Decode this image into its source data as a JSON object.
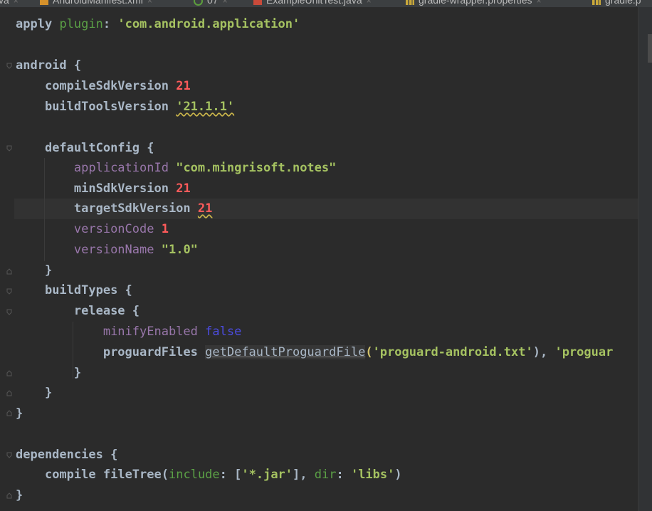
{
  "tabs": [
    {
      "label": "va",
      "icon": "java-file-icon"
    },
    {
      "label": "AndroidManifest.xml",
      "icon": "xml-file-icon"
    },
    {
      "label": "07",
      "icon": "refresh-icon"
    },
    {
      "label": "ExampleUnitTest.java",
      "icon": "java-test-file-icon"
    },
    {
      "label": "gradle-wrapper.properties",
      "icon": "properties-file-icon"
    },
    {
      "label": "gradle.p",
      "icon": "properties-file-icon"
    }
  ],
  "close_glyph": "×",
  "colors": {
    "background": "#2b2b2b",
    "keyword": "#a9b7c6",
    "string": "#6a8759",
    "number": "#ff5b5b",
    "property": "#9876aa",
    "named_arg": "#467cda"
  },
  "code": {
    "l1": [
      "apply",
      "plugin",
      ": ",
      "'com.android.application'"
    ],
    "l3": [
      "android",
      " {"
    ],
    "l4": [
      "compileSdkVersion",
      "21"
    ],
    "l5": [
      "buildToolsVersion",
      "'21.1.1'"
    ],
    "l7": [
      "defaultConfig",
      " {"
    ],
    "l8": [
      "applicationId",
      "\"com.mingrisoft.notes\""
    ],
    "l9": [
      "minSdkVersion",
      "21"
    ],
    "l10": [
      "targetSdkVersion",
      "21"
    ],
    "l11": [
      "versionCode",
      "1"
    ],
    "l12": [
      "versionName",
      "\"1.0\""
    ],
    "l13": [
      "}"
    ],
    "l14": [
      "buildTypes",
      " {"
    ],
    "l15": [
      "release",
      " {"
    ],
    "l16": [
      "minifyEnabled",
      "false"
    ],
    "l17": [
      "proguardFiles",
      "getDefaultProguardFile",
      "(",
      "'proguard-android.txt'",
      "), ",
      "'proguar"
    ],
    "l18": [
      "}"
    ],
    "l19": [
      "}"
    ],
    "l20": [
      "}"
    ],
    "l22": [
      "dependencies",
      " {"
    ],
    "l23": [
      "compile",
      "fileTree",
      "(",
      "include",
      ": [",
      "'*.jar'",
      "], ",
      "dir",
      ": ",
      "'libs'",
      ")"
    ],
    "l24": [
      "}"
    ]
  }
}
